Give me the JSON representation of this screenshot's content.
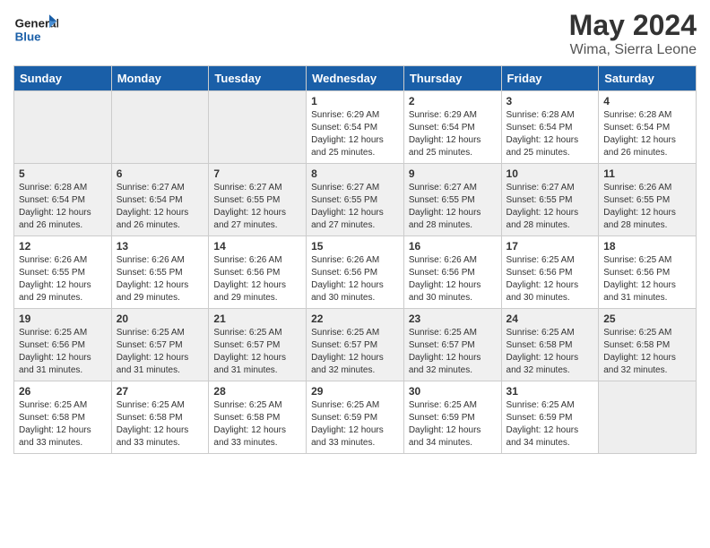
{
  "header": {
    "logo_line1": "General",
    "logo_line2": "Blue",
    "title": "May 2024",
    "subtitle": "Wima, Sierra Leone"
  },
  "days_of_week": [
    "Sunday",
    "Monday",
    "Tuesday",
    "Wednesday",
    "Thursday",
    "Friday",
    "Saturday"
  ],
  "weeks": [
    [
      {
        "day": "",
        "info": ""
      },
      {
        "day": "",
        "info": ""
      },
      {
        "day": "",
        "info": ""
      },
      {
        "day": "1",
        "info": "Sunrise: 6:29 AM\nSunset: 6:54 PM\nDaylight: 12 hours\nand 25 minutes."
      },
      {
        "day": "2",
        "info": "Sunrise: 6:29 AM\nSunset: 6:54 PM\nDaylight: 12 hours\nand 25 minutes."
      },
      {
        "day": "3",
        "info": "Sunrise: 6:28 AM\nSunset: 6:54 PM\nDaylight: 12 hours\nand 25 minutes."
      },
      {
        "day": "4",
        "info": "Sunrise: 6:28 AM\nSunset: 6:54 PM\nDaylight: 12 hours\nand 26 minutes."
      }
    ],
    [
      {
        "day": "5",
        "info": "Sunrise: 6:28 AM\nSunset: 6:54 PM\nDaylight: 12 hours\nand 26 minutes."
      },
      {
        "day": "6",
        "info": "Sunrise: 6:27 AM\nSunset: 6:54 PM\nDaylight: 12 hours\nand 26 minutes."
      },
      {
        "day": "7",
        "info": "Sunrise: 6:27 AM\nSunset: 6:55 PM\nDaylight: 12 hours\nand 27 minutes."
      },
      {
        "day": "8",
        "info": "Sunrise: 6:27 AM\nSunset: 6:55 PM\nDaylight: 12 hours\nand 27 minutes."
      },
      {
        "day": "9",
        "info": "Sunrise: 6:27 AM\nSunset: 6:55 PM\nDaylight: 12 hours\nand 28 minutes."
      },
      {
        "day": "10",
        "info": "Sunrise: 6:27 AM\nSunset: 6:55 PM\nDaylight: 12 hours\nand 28 minutes."
      },
      {
        "day": "11",
        "info": "Sunrise: 6:26 AM\nSunset: 6:55 PM\nDaylight: 12 hours\nand 28 minutes."
      }
    ],
    [
      {
        "day": "12",
        "info": "Sunrise: 6:26 AM\nSunset: 6:55 PM\nDaylight: 12 hours\nand 29 minutes."
      },
      {
        "day": "13",
        "info": "Sunrise: 6:26 AM\nSunset: 6:55 PM\nDaylight: 12 hours\nand 29 minutes."
      },
      {
        "day": "14",
        "info": "Sunrise: 6:26 AM\nSunset: 6:56 PM\nDaylight: 12 hours\nand 29 minutes."
      },
      {
        "day": "15",
        "info": "Sunrise: 6:26 AM\nSunset: 6:56 PM\nDaylight: 12 hours\nand 30 minutes."
      },
      {
        "day": "16",
        "info": "Sunrise: 6:26 AM\nSunset: 6:56 PM\nDaylight: 12 hours\nand 30 minutes."
      },
      {
        "day": "17",
        "info": "Sunrise: 6:25 AM\nSunset: 6:56 PM\nDaylight: 12 hours\nand 30 minutes."
      },
      {
        "day": "18",
        "info": "Sunrise: 6:25 AM\nSunset: 6:56 PM\nDaylight: 12 hours\nand 31 minutes."
      }
    ],
    [
      {
        "day": "19",
        "info": "Sunrise: 6:25 AM\nSunset: 6:56 PM\nDaylight: 12 hours\nand 31 minutes."
      },
      {
        "day": "20",
        "info": "Sunrise: 6:25 AM\nSunset: 6:57 PM\nDaylight: 12 hours\nand 31 minutes."
      },
      {
        "day": "21",
        "info": "Sunrise: 6:25 AM\nSunset: 6:57 PM\nDaylight: 12 hours\nand 31 minutes."
      },
      {
        "day": "22",
        "info": "Sunrise: 6:25 AM\nSunset: 6:57 PM\nDaylight: 12 hours\nand 32 minutes."
      },
      {
        "day": "23",
        "info": "Sunrise: 6:25 AM\nSunset: 6:57 PM\nDaylight: 12 hours\nand 32 minutes."
      },
      {
        "day": "24",
        "info": "Sunrise: 6:25 AM\nSunset: 6:58 PM\nDaylight: 12 hours\nand 32 minutes."
      },
      {
        "day": "25",
        "info": "Sunrise: 6:25 AM\nSunset: 6:58 PM\nDaylight: 12 hours\nand 32 minutes."
      }
    ],
    [
      {
        "day": "26",
        "info": "Sunrise: 6:25 AM\nSunset: 6:58 PM\nDaylight: 12 hours\nand 33 minutes."
      },
      {
        "day": "27",
        "info": "Sunrise: 6:25 AM\nSunset: 6:58 PM\nDaylight: 12 hours\nand 33 minutes."
      },
      {
        "day": "28",
        "info": "Sunrise: 6:25 AM\nSunset: 6:58 PM\nDaylight: 12 hours\nand 33 minutes."
      },
      {
        "day": "29",
        "info": "Sunrise: 6:25 AM\nSunset: 6:59 PM\nDaylight: 12 hours\nand 33 minutes."
      },
      {
        "day": "30",
        "info": "Sunrise: 6:25 AM\nSunset: 6:59 PM\nDaylight: 12 hours\nand 34 minutes."
      },
      {
        "day": "31",
        "info": "Sunrise: 6:25 AM\nSunset: 6:59 PM\nDaylight: 12 hours\nand 34 minutes."
      },
      {
        "day": "",
        "info": ""
      }
    ]
  ]
}
